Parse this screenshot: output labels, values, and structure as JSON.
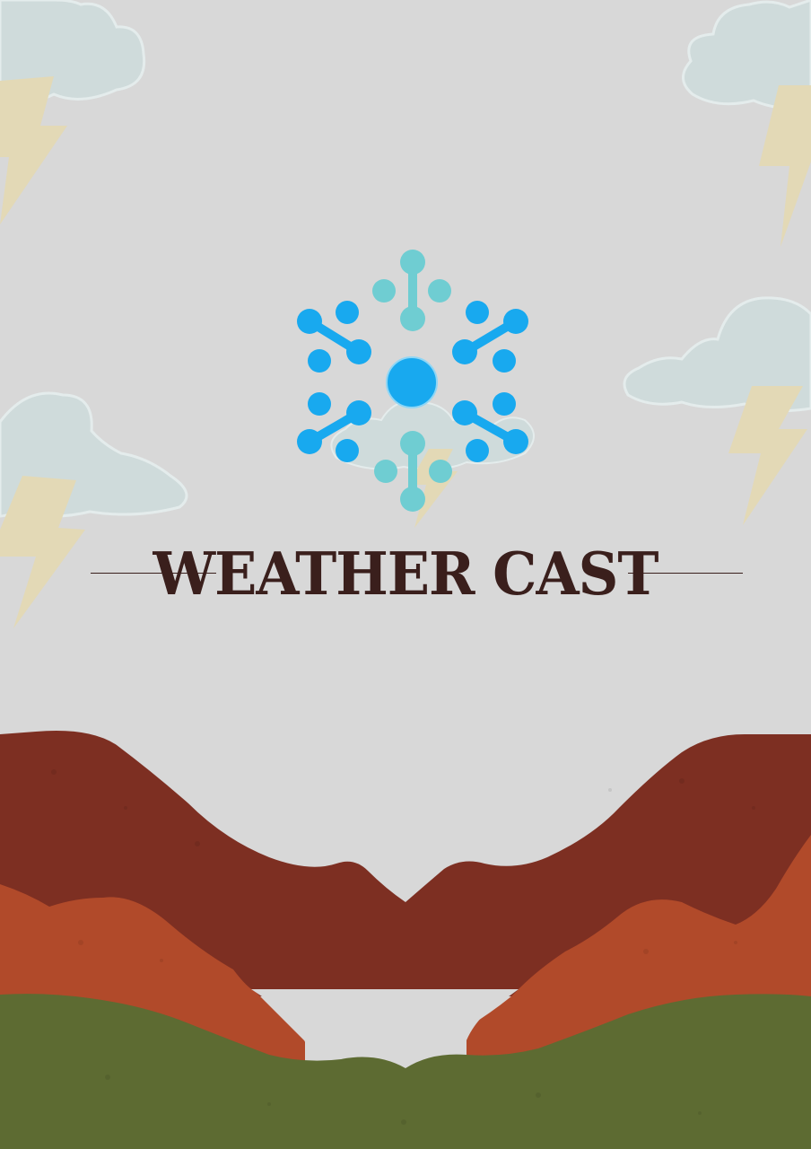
{
  "poster": {
    "title": "WEATHER CAST"
  },
  "icons": {
    "logo": "snowflake-dots-icon",
    "clouds": "storm-cloud-icon",
    "bolts": "lightning-bolt-icon"
  },
  "colors": {
    "background": "#d8d8d8",
    "cloud": "#cfdbdb",
    "bolt": "#e3d9b6",
    "logo_blue": "#18a9ef",
    "logo_teal": "#6fcdd2",
    "title": "#3a1f1c",
    "mountain_far": "#7d2f22",
    "mountain_mid": "#b14a2a",
    "hill_green": "#5d6b32"
  }
}
